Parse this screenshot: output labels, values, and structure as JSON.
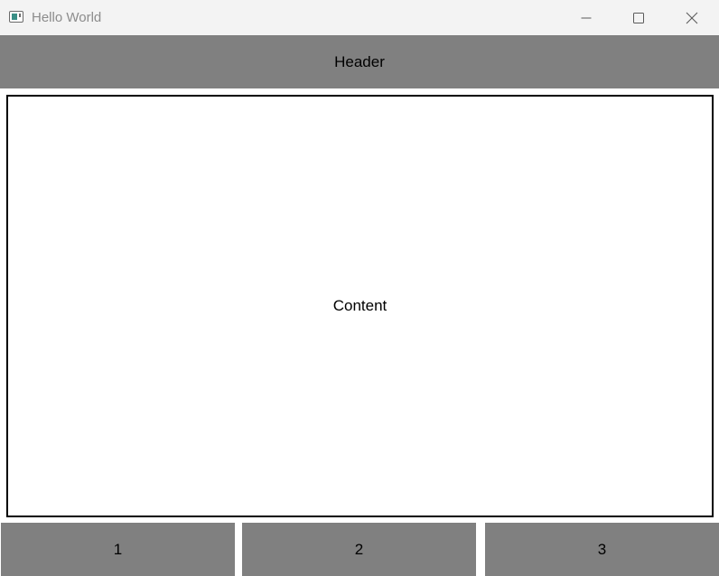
{
  "window": {
    "title": "Hello World",
    "icon": "app-window-icon",
    "controls": {
      "minimize_icon": "minimize-icon",
      "maximize_icon": "maximize-icon",
      "close_icon": "close-icon"
    }
  },
  "header": {
    "label": "Header"
  },
  "content": {
    "label": "Content"
  },
  "footer": {
    "buttons": [
      {
        "label": "1"
      },
      {
        "label": "2"
      },
      {
        "label": "3"
      }
    ]
  },
  "colors": {
    "titlebar": "#f3f3f3",
    "panel_gray": "#808080",
    "content_bg": "#ffffff",
    "border": "#000000",
    "title_text": "#8c8c8c"
  }
}
